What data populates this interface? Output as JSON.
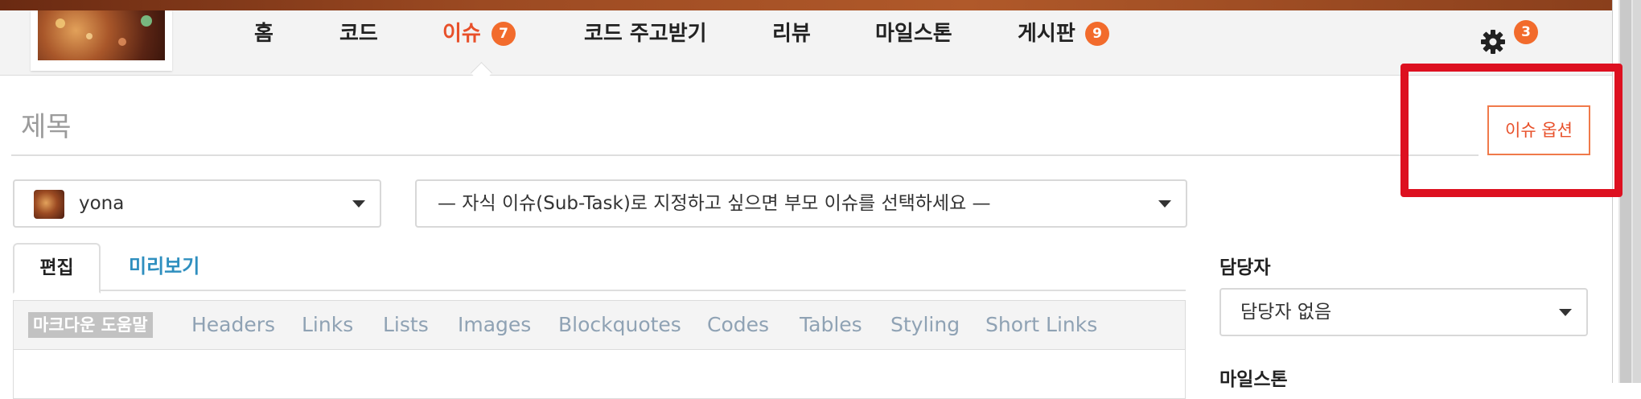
{
  "nav": {
    "items": [
      {
        "label": "홈"
      },
      {
        "label": "코드"
      },
      {
        "label": "이슈",
        "badge": "7",
        "active": true
      },
      {
        "label": "코드 주고받기"
      },
      {
        "label": "리뷰"
      },
      {
        "label": "마일스톤"
      },
      {
        "label": "게시판",
        "badge": "9"
      }
    ],
    "settings_badge": "3",
    "settings_icon": "gear-icon"
  },
  "form": {
    "title_placeholder": "제목",
    "options_button": "이슈 옵션",
    "author": "yona",
    "parent_placeholder": "— 자식 이슈(Sub-Task)로 지정하고 싶으면 부모 이슈를 선택하세요 —"
  },
  "editor": {
    "tabs": {
      "edit": "편집",
      "preview": "미리보기"
    },
    "help_label": "마크다운 도움말",
    "help_links": [
      "Headers",
      "Links",
      "Lists",
      "Images",
      "Blockquotes",
      "Codes",
      "Tables",
      "Styling",
      "Short Links"
    ]
  },
  "sidebar": {
    "assignee_label": "담당자",
    "assignee_value": "담당자 없음",
    "milestone_label": "마일스톤"
  },
  "colors": {
    "accent": "#e8502a",
    "badge": "#f26b2c",
    "link": "#2f8fbf",
    "highlight": "#dd1020"
  }
}
